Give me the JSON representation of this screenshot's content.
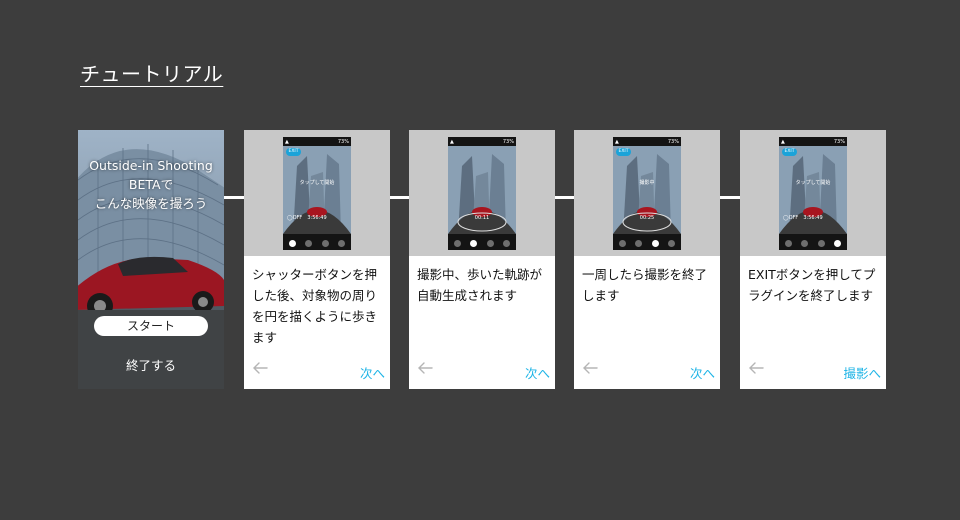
{
  "page": {
    "title": "チュートリアル"
  },
  "start_card": {
    "title_lines": [
      "Outside-in Shooting",
      "BETAで",
      "こんな映像を撮ろう"
    ],
    "start_button": "スタート",
    "exit_label": "終了する"
  },
  "cards": [
    {
      "description": "シャッターボタンを押した後、対象物の周りを円を描くように歩きます",
      "next_label": "次へ",
      "phone": {
        "battery": "73%",
        "exit": "EXIT",
        "overlay": "タップして開始",
        "status_left": "◯OFF",
        "info": "3:56:49",
        "active_dot": 0
      }
    },
    {
      "description": "撮影中、歩いた軌跡が自動生成されます",
      "next_label": "次へ",
      "phone": {
        "battery": "73%",
        "exit": "",
        "overlay": "",
        "status_left": "",
        "info": "00:11",
        "active_dot": 1
      }
    },
    {
      "description": "一周したら撮影を終了します",
      "next_label": "次へ",
      "phone": {
        "battery": "73%",
        "exit": "EXIT",
        "overlay": "撮影中",
        "status_left": "",
        "info": "00:25",
        "active_dot": 2
      }
    },
    {
      "description": "EXITボタンを押してプラグインを終了します",
      "next_label": "撮影へ",
      "phone": {
        "battery": "73%",
        "exit": "EXIT",
        "overlay": "タップして開始",
        "status_left": "◯OFF",
        "info": "3:56:49",
        "active_dot": 3
      }
    }
  ],
  "colors": {
    "background": "#3d3d3d",
    "accent": "#1eb4e6",
    "exit_badge": "#1aa3d9"
  },
  "icons": {
    "back": "arrow-left-icon",
    "app": "shield-icon",
    "battery": "battery-icon"
  }
}
